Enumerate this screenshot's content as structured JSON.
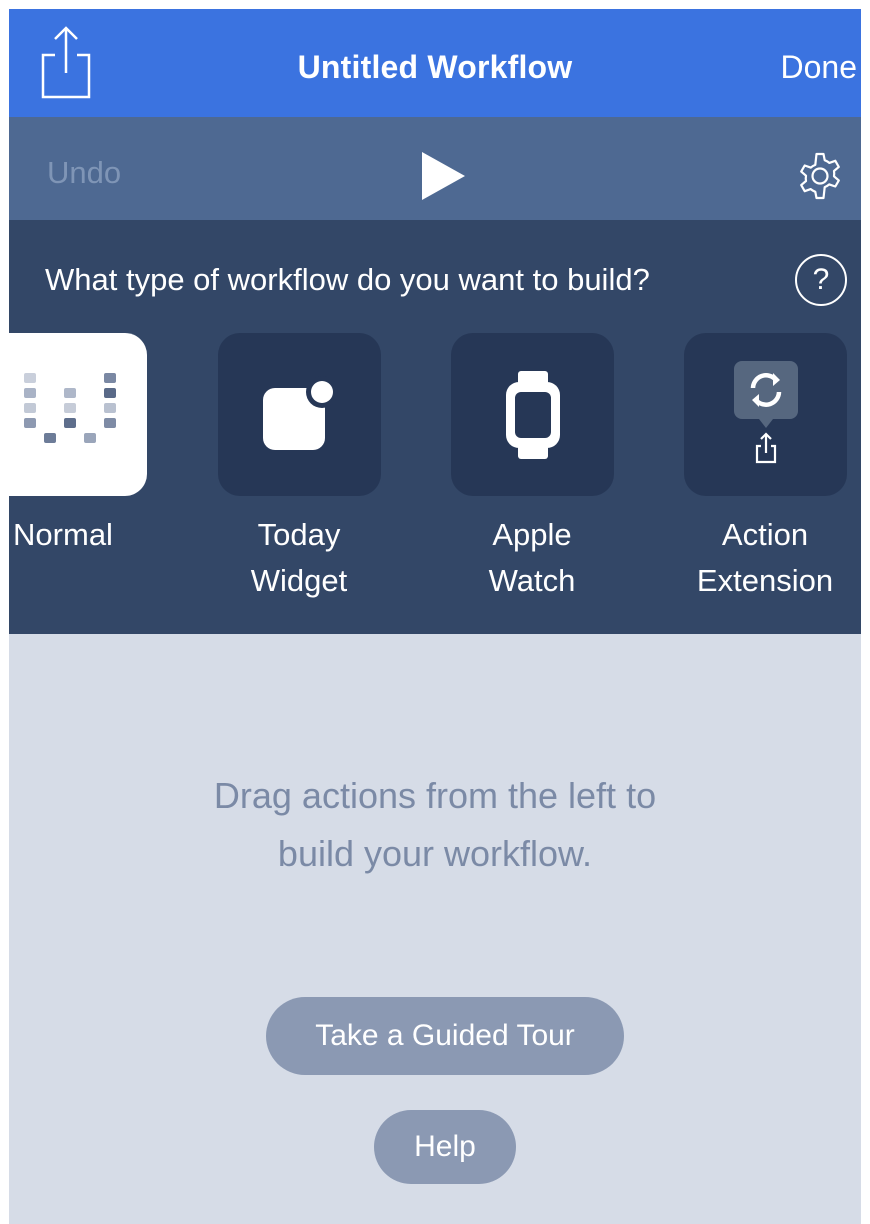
{
  "navbar": {
    "title": "Untitled Workflow",
    "done_label": "Done",
    "share_icon": "share-icon",
    "background": "#3b73e0"
  },
  "toolbar": {
    "undo_label": "Undo",
    "play_icon": "play-icon",
    "settings_icon": "gear-icon",
    "background": "#4e6992"
  },
  "picker": {
    "question": "What type of workflow do you want to build?",
    "help_symbol": "?",
    "types": [
      {
        "line1": "Normal",
        "line2": "",
        "icon": "workflow-logo-icon",
        "selected": true
      },
      {
        "line1": "Today",
        "line2": "Widget",
        "icon": "today-widget-icon",
        "selected": false
      },
      {
        "line1": "Apple",
        "line2": "Watch",
        "icon": "apple-watch-icon",
        "selected": false
      },
      {
        "line1": "Action",
        "line2": "Extension",
        "icon": "action-extension-icon",
        "selected": false
      }
    ],
    "background": "#334767"
  },
  "empty_state": {
    "line1": "Drag actions from the left to",
    "line2": "build your workflow.",
    "tour_button": "Take a Guided Tour",
    "help_button": "Help"
  }
}
